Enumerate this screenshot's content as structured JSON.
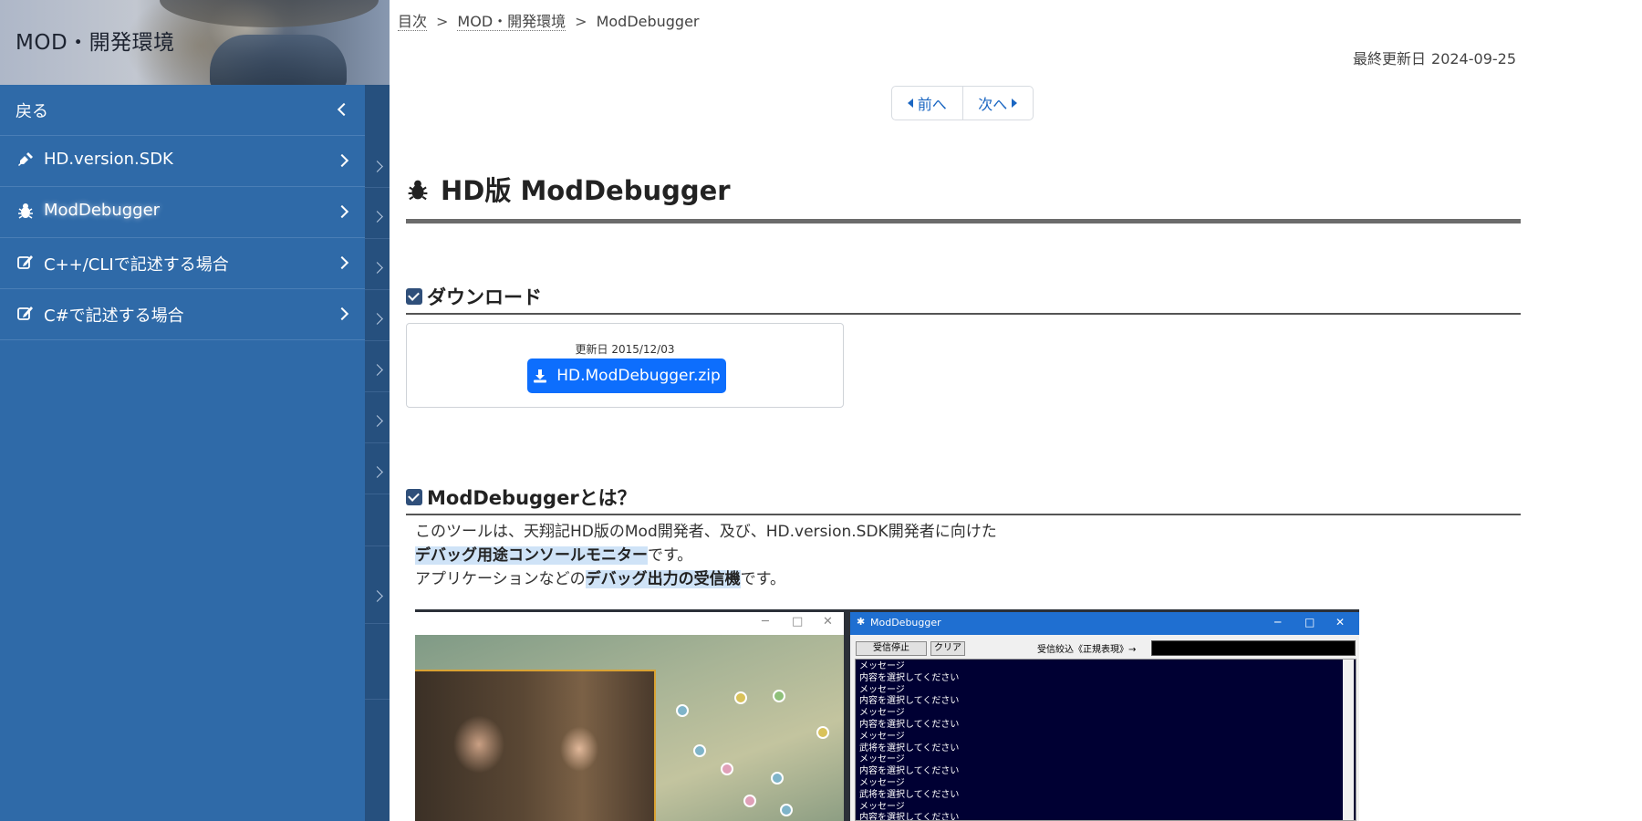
{
  "sidebar": {
    "title": "MOD・開発環境",
    "back_label": "戻る",
    "items": [
      {
        "label": "HD.version.SDK",
        "icon": "plug-icon"
      },
      {
        "label": "ModDebugger",
        "icon": "bug-icon"
      },
      {
        "label": "C++/CLIで記述する場合",
        "icon": "edit-icon"
      },
      {
        "label": "C#で記述する場合",
        "icon": "edit-icon"
      }
    ]
  },
  "breadcrumb": {
    "items": [
      "目次",
      "MOD・開発環境",
      "ModDebugger"
    ],
    "separator": ">"
  },
  "last_updated": {
    "label": "最終更新日",
    "value": "2024-09-25"
  },
  "pager": {
    "prev_label": "前へ",
    "next_label": "次へ"
  },
  "page_title": "HD版 ModDebugger",
  "sections": {
    "download": {
      "heading": "ダウンロード",
      "date_text": "更新日 2015/12/03",
      "button_label": "HD.ModDebugger.zip"
    },
    "about": {
      "heading": "ModDebuggerとは？",
      "line1": "このツールは、天翔記HD版のMod開発者、及び、HD.version.SDK開発者に向けた",
      "line2_highlight": "デバッグ用途コンソールモニター",
      "line2_rest": "です。",
      "line3_pre": "アプリケーションなどの",
      "line3_highlight": "デバッグ出力の受信機",
      "line3_rest": "です。"
    }
  },
  "figure": {
    "debugger_window_title": "ModDebugger",
    "stop_button": "受信停止",
    "clear_button": "クリア",
    "filter_label": "受信絞込《正規表現》→",
    "console_lines": [
      "メッセージ",
      "内容を選択してください",
      "メッセージ",
      "内容を選択してください",
      "メッセージ",
      "内容を選択してください",
      "メッセージ",
      "武将を選択してください",
      "メッセージ",
      "内容を選択してください",
      "メッセージ",
      "武将を選択してください",
      "メッセージ",
      "内容を選択してください"
    ]
  },
  "colors": {
    "sidebar_bg": "#2f6aa8",
    "accent": "#0d6efd",
    "link": "#1a66c2",
    "heading_check": "#2f4f7a"
  }
}
